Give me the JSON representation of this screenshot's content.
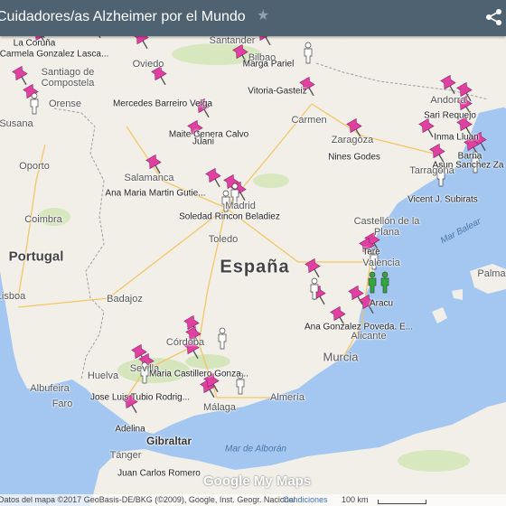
{
  "header": {
    "title": "Cuidadores/as Alzheimer por el Mundo"
  },
  "colors": {
    "sea": "#a4c7f2",
    "land": "#f2efe9",
    "header": "#4f6272",
    "pin": "#e040a0",
    "person_white": "#ffffff",
    "person_green": "#2eaa3a"
  },
  "map": {
    "country_labels": [
      "España",
      "Portugal"
    ],
    "sea_labels": [
      "Mar Balear",
      "Mar de Alborán"
    ],
    "bold_labels": [
      "Gibraltar"
    ],
    "cities": [
      "Santander",
      "Bilbao",
      "Oviedo",
      "Santiago de Compostela",
      "Orense",
      "Susana",
      "Oporto",
      "Coimbra",
      "Lisboa",
      "Badajoz",
      "Toledo",
      "Salamanca",
      "Zaragoza",
      "Andorra",
      "Castellón de la Plana",
      "Valencia",
      "Alicante",
      "Murcia",
      "Huelva",
      "Sevilla",
      "Albufeira",
      "Faro",
      "Málaga",
      "Almería",
      "Tánger",
      "Palma",
      "Córdoba",
      "Carmen",
      "Madrid",
      "Tarragona"
    ],
    "pin_labels": [
      "La Coruña",
      "Carmela Gonzalez Lasca...",
      "Marga Pariel",
      "Vitoria-Gasteiz",
      "Mercedes Barreiro Veiga",
      "Maite Cenera Calvo",
      "Juani",
      "Ana Maria Martin Gutie...",
      "Soledad Rincon Beladiez",
      "Nines Godes",
      "Sari Requejo",
      "Inma Lluan",
      "Barna",
      "Asun Sanchez Za",
      "Vicent J. Subirats",
      "Tere",
      "Aracu",
      "Ana Gonzalez Poveda. E...",
      "Maria Castillero Gonza...",
      "Jose Luis Tubio Rodrig...",
      "Adelina",
      "Juan Carlos Romero"
    ],
    "pin_count": 40,
    "person_markers_white": 11,
    "person_markers_green": 2
  },
  "footer": {
    "attribution": "Datos del mapa ©2017 GeoBasis-DE/BKG (©2009), Google, Inst. Geogr. Nacional",
    "terms": "Condiciones",
    "scale": "100 km"
  },
  "branding": {
    "logo": "Google My Maps"
  },
  "icons": {
    "star": "star-icon",
    "share": "share-icon",
    "pin": "map-pin-icon",
    "person": "person-marker-icon"
  }
}
